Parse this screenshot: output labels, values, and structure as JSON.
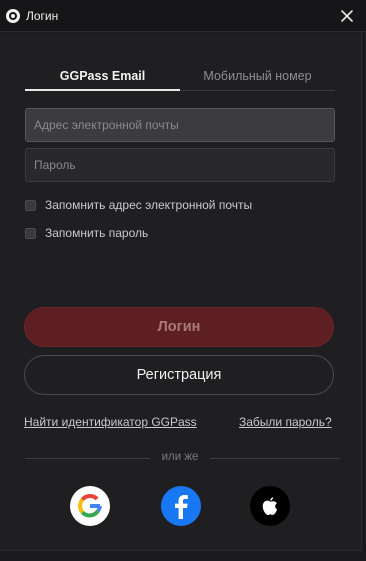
{
  "window": {
    "title": "Логин",
    "app_icon": "gg-logo-icon",
    "close_icon": "close-icon"
  },
  "tabs": [
    {
      "label": "GGPass Email",
      "active": true
    },
    {
      "label": "Мобильный номер",
      "active": false
    }
  ],
  "form": {
    "email_placeholder": "Адрес электронной почты",
    "email_value": "",
    "password_placeholder": "Пароль",
    "password_value": "",
    "remember_email_label": "Запомнить адрес электронной почты",
    "remember_email_checked": false,
    "remember_password_label": "Запомнить пароль",
    "remember_password_checked": false
  },
  "buttons": {
    "login_label": "Логин",
    "register_label": "Регистрация"
  },
  "links": {
    "find_id": "Найти идентификатор GGPass",
    "forgot_password": "Забыли пароль?"
  },
  "social": {
    "divider_text": "или же",
    "providers": [
      {
        "icon": "google-icon",
        "color": "#ffffff"
      },
      {
        "icon": "facebook-icon",
        "color": "#1877f2"
      },
      {
        "icon": "apple-icon",
        "color": "#000000"
      }
    ]
  },
  "colors": {
    "login_button": "#5e1f23",
    "background": "#1f1e21"
  }
}
